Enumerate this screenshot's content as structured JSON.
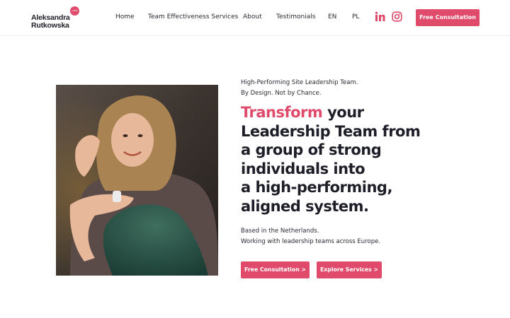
{
  "brand": {
    "name_line1": "Aleksandra",
    "name_line2": "Rutkowska",
    "badge": ".com",
    "accent_color": "#e04b6c"
  },
  "nav": {
    "items": [
      {
        "label": "Home"
      },
      {
        "label": "Team Effectiveness Services"
      },
      {
        "label": "About"
      },
      {
        "label": "Testimonials"
      },
      {
        "label": "EN"
      },
      {
        "label": "PL"
      }
    ],
    "social": [
      {
        "icon": "linkedin-icon"
      },
      {
        "icon": "instagram-icon"
      }
    ],
    "cta_label": "Free Consultation"
  },
  "hero": {
    "tagline_line1": "High-Performing Site Leadership Team.",
    "tagline_line2": "By Design. Not by Chance.",
    "headline_accent": "Transform",
    "headline_rest1": " your",
    "headline_line2": "Leadership Team from",
    "headline_line3": "a group of strong",
    "headline_line4": "individuals into",
    "headline_line5": "a high-performing,",
    "headline_line6": "aligned system.",
    "location_line1": "Based in the Netherlands.",
    "location_line2": "Working with leadership teams across Europe.",
    "primary_button": "Free Consultation >",
    "secondary_button": "Explore Services >"
  }
}
